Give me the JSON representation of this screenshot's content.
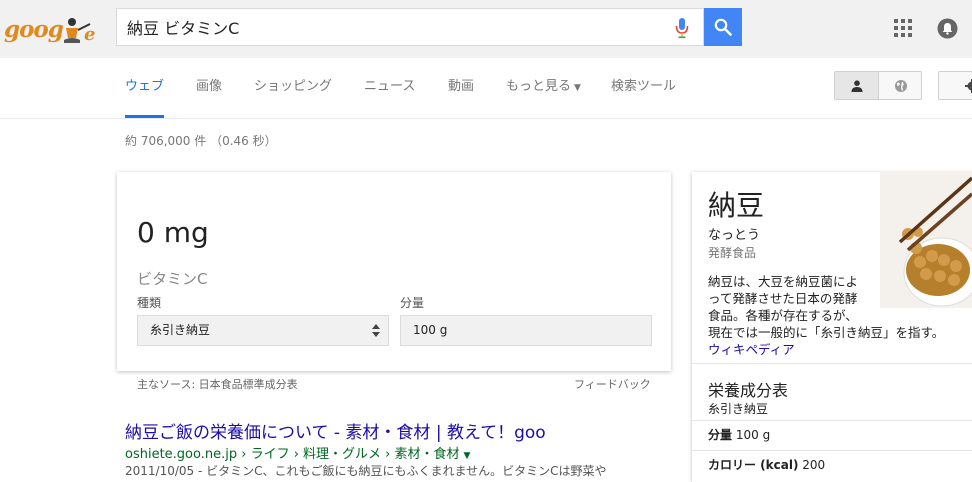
{
  "header": {
    "logo_text": "goog",
    "search_query": "納豆 ビタミンC"
  },
  "tabs": [
    {
      "label": "ウェブ",
      "active": true
    },
    {
      "label": "画像"
    },
    {
      "label": "ショッピング"
    },
    {
      "label": "ニュース"
    },
    {
      "label": "動画"
    },
    {
      "label": "もっと見る"
    },
    {
      "label": "検索ツール"
    }
  ],
  "result_stats": "約 706,000 件 （0.46 秒）",
  "nutrition_card": {
    "value": "0 mg",
    "nutrient": "ビタミンC",
    "food_label": "種類",
    "food_value": "糸引き納豆",
    "amount_label": "分量",
    "amount_value": "100 g",
    "source": "主なソース: 日本食品標準成分表",
    "feedback": "フィードバック"
  },
  "result": {
    "title": "納豆ご飯の栄養価について - 素材・食材 | 教えて！goo",
    "url": "oshiete.goo.ne.jp › ライフ › 料理・グルメ › 素材・食材",
    "snippet": "2011/10/05 - ビタミンC、これもご飯にも納豆にもふくまれません。ビタミンCは野菜や"
  },
  "knowledge_panel": {
    "title": "納豆",
    "reading": "なっとう",
    "category": "発酵食品",
    "desc_lines": [
      "納豆は、大豆を納豆菌によ",
      "って発酵させた日本の発酵",
      "食品。各種が存在するが、",
      "現在では一般的に「糸引き納豆」を指す。"
    ],
    "wiki_link": "ウィキペディア",
    "nutrition_title": "栄養成分表",
    "nutrition_sub": "糸引き納豆",
    "rows": [
      {
        "label": "分量",
        "value": "100 g"
      },
      {
        "label": "カロリー (kcal)",
        "value": "200"
      }
    ]
  },
  "colors": {
    "accent": "#1a73e8",
    "search_button": "#4285f4",
    "link": "#1a0dab",
    "url": "#006621",
    "logo": "#e08a1e"
  },
  "icons": [
    "microphone-icon",
    "search-icon",
    "apps-grid-icon",
    "notifications-icon",
    "person-icon",
    "globe-icon",
    "gear-icon",
    "chevron-down-icon",
    "updown-arrows-icon"
  ]
}
